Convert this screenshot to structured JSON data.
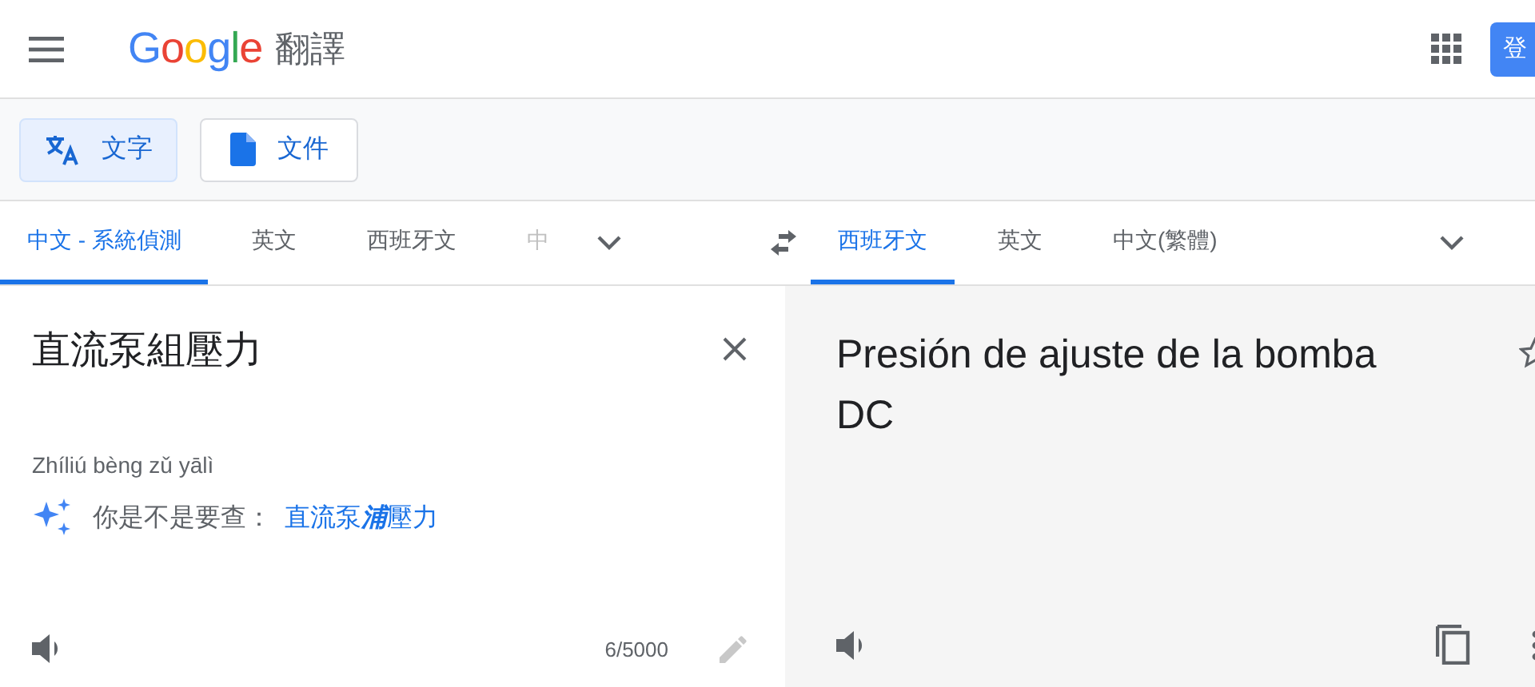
{
  "header": {
    "logo": "Google",
    "product": "翻譯",
    "login_button": "登"
  },
  "modes": [
    {
      "label": "文字",
      "selected": true,
      "kind": "text"
    },
    {
      "label": "文件",
      "selected": false,
      "kind": "document"
    }
  ],
  "source_languages": [
    {
      "label": "中文 - 系統偵測",
      "selected": true
    },
    {
      "label": "英文",
      "selected": false
    },
    {
      "label": "西班牙文",
      "selected": false
    },
    {
      "label": "中",
      "selected": false
    }
  ],
  "target_languages": [
    {
      "label": "西班牙文",
      "selected": true
    },
    {
      "label": "英文",
      "selected": false
    },
    {
      "label": "中文(繁體)",
      "selected": false
    }
  ],
  "source": {
    "text": "直流泵組壓力",
    "pinyin": "Zhíliú bèng zǔ yālì",
    "suggestion_label": "你是不是要查：",
    "suggestion": [
      {
        "text": "直流泵",
        "corrected": false
      },
      {
        "text": "浦",
        "corrected": true
      },
      {
        "text": "壓力",
        "corrected": false
      }
    ],
    "char_count": "6/5000"
  },
  "target": {
    "text": "Presión de ajuste de la bomba DC"
  }
}
